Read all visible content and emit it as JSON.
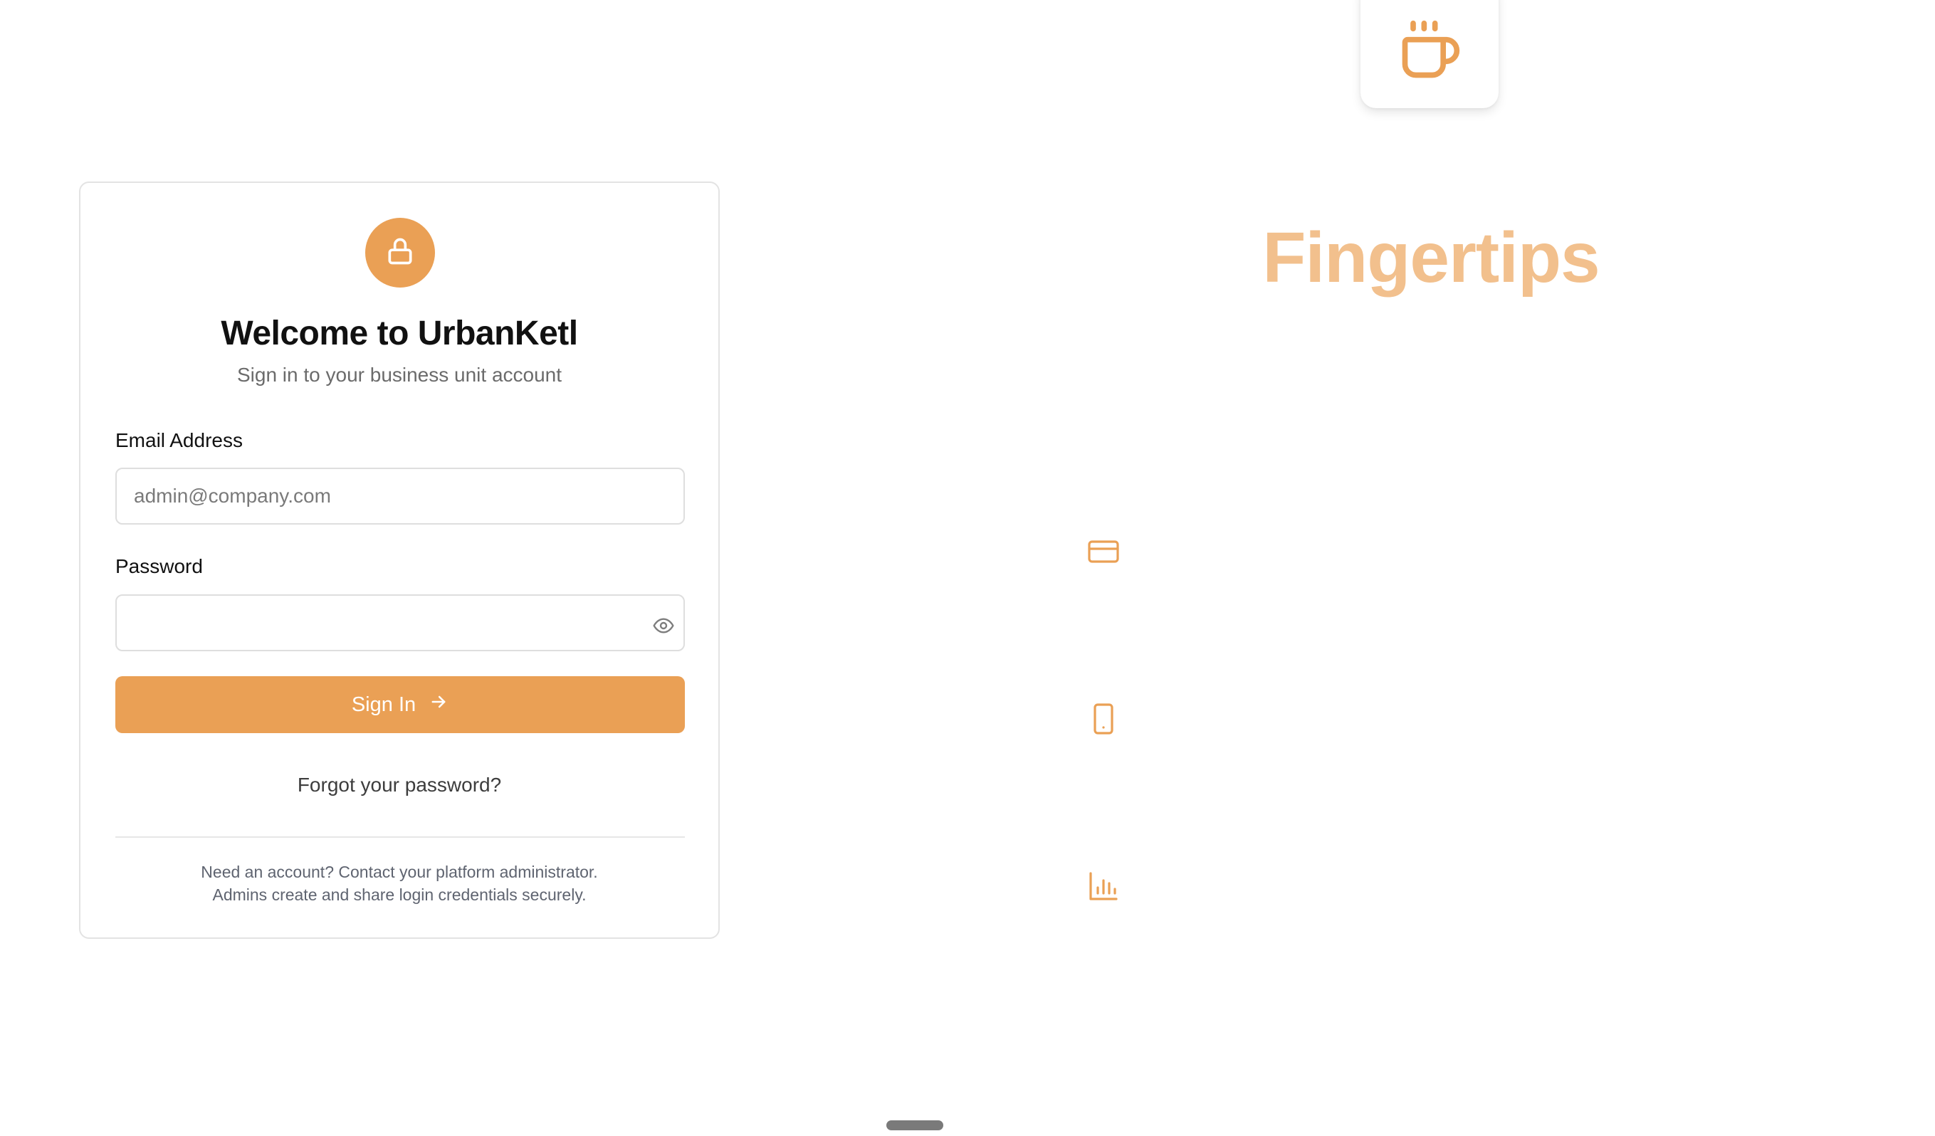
{
  "login": {
    "title": "Welcome to UrbanKetl",
    "subtitle": "Sign in to your business unit account",
    "email_label": "Email Address",
    "email_placeholder": "admin@company.com",
    "email_value": "",
    "password_label": "Password",
    "password_value": "",
    "signin_label": "Sign In",
    "forgot_label": "Forgot your password?",
    "footer_line1": "Need an account? Contact your platform administrator.",
    "footer_line2": "Admins create and share login credentials securely."
  },
  "brand": {
    "title": "Fingertips"
  },
  "icons": {
    "header": "lock-icon",
    "password_toggle": "eye-icon",
    "signin": "arrow-right-icon",
    "brand_tile": "coffee-cup-icon",
    "features": [
      "credit-card-icon",
      "tablet-icon",
      "bar-chart-icon"
    ]
  },
  "colors": {
    "accent": "#eaa055",
    "brand_title": "#f2c08d",
    "icon_stroke": "#eaa055"
  }
}
